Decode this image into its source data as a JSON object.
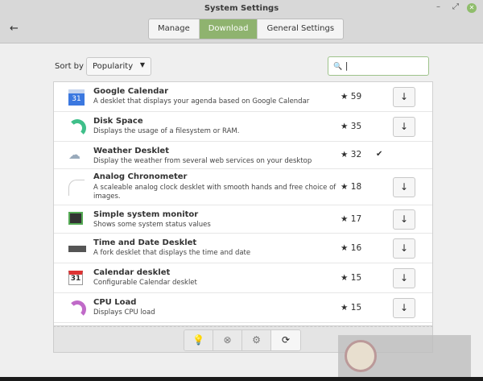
{
  "window": {
    "title": "System Settings",
    "minimize": "–",
    "maximize": "⤢",
    "close": "✕",
    "back": "←"
  },
  "tabs": [
    {
      "label": "Manage"
    },
    {
      "label": "Download"
    },
    {
      "label": "General Settings"
    }
  ],
  "sort": {
    "label": "Sort by",
    "value": "Popularity",
    "caret": "▼"
  },
  "search": {
    "icon": "🔍",
    "value": "|"
  },
  "items": [
    {
      "name": "Google Calendar",
      "desc": "A desklet that displays your agenda based on Google Calendar",
      "score": "59",
      "installed": false
    },
    {
      "name": "Disk Space",
      "desc": "Displays the usage of a filesystem or RAM.",
      "score": "35",
      "installed": false
    },
    {
      "name": "Weather Desklet",
      "desc": "Display the weather from several web services on your desktop",
      "score": "32",
      "installed": true
    },
    {
      "name": "Analog Chronometer",
      "desc": "A scaleable analog clock desklet with smooth hands and free choice of images.",
      "score": "18",
      "installed": false
    },
    {
      "name": "Simple system monitor",
      "desc": "Shows some system status values",
      "score": "17",
      "installed": false
    },
    {
      "name": "Time and Date Desklet",
      "desc": "A fork desklet that displays the time and date",
      "score": "16",
      "installed": false
    },
    {
      "name": "Calendar desklet",
      "desc": "Configurable Calendar desklet",
      "score": "15",
      "installed": false
    },
    {
      "name": "CPU Load",
      "desc": "Displays CPU load",
      "score": "15",
      "installed": false
    }
  ],
  "glyphs": {
    "star": "★",
    "check": "✔",
    "download": "↓",
    "gcal": "31",
    "cal": "31"
  },
  "toolbar": {
    "info": "💡",
    "remove": "⊗",
    "configure": "⚙",
    "refresh": "⟳"
  },
  "accent": "#8fb36f"
}
